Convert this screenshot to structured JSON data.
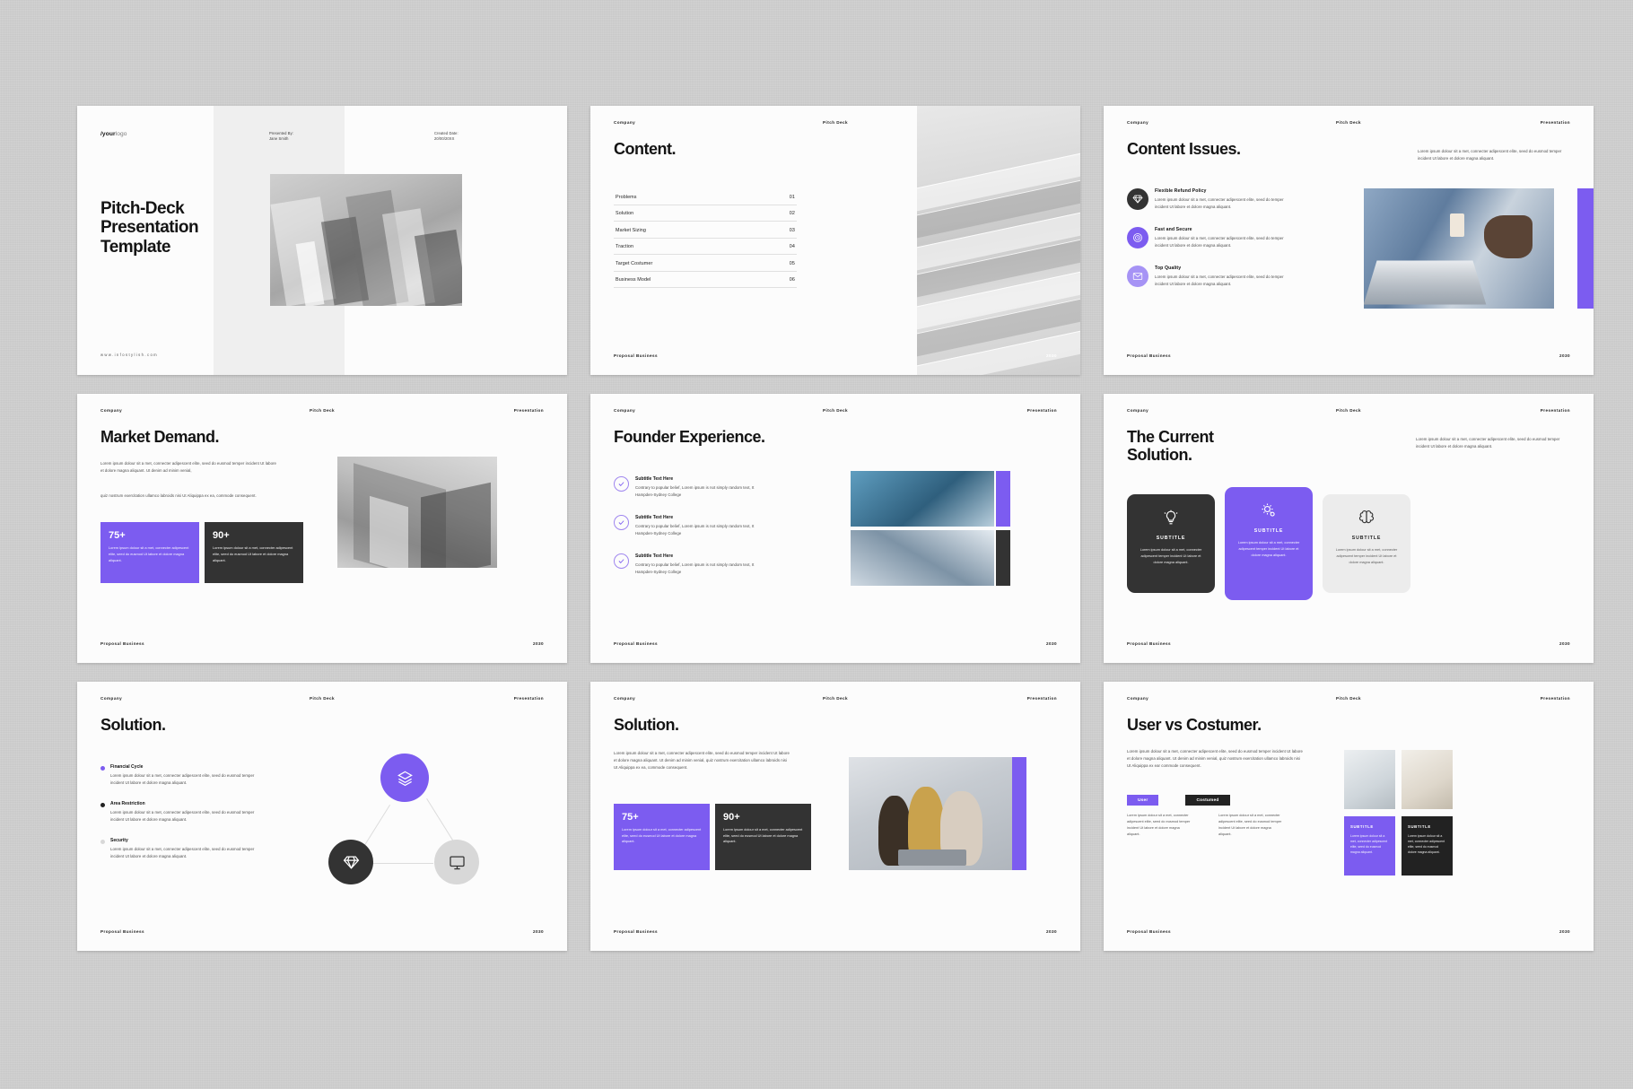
{
  "common": {
    "header_left": "Company",
    "header_center": "Pitch Deck",
    "header_right": "Presentation",
    "footer_left": "Proposal Business",
    "footer_right": "2030"
  },
  "slides": [
    {
      "id": "cover",
      "logo_bold": "/your",
      "logo_light": "logo",
      "presented_by_label": "Presented By:",
      "presented_by_name": "Jane Smith",
      "created_label": "Created Date:",
      "created_value": "20/00/20XX",
      "title": "Pitch-Deck Presentation Template",
      "url": "www.infostylish.com"
    },
    {
      "id": "content",
      "title": "Content.",
      "items": [
        {
          "label": "Problems",
          "num": "01"
        },
        {
          "label": "Solution",
          "num": "02"
        },
        {
          "label": "Market Sizing",
          "num": "03"
        },
        {
          "label": "Traction",
          "num": "04"
        },
        {
          "label": "Target Costumer",
          "num": "05"
        },
        {
          "label": "Business Model",
          "num": "06"
        }
      ]
    },
    {
      "id": "content-issues",
      "title": "Content Issues.",
      "lead": "Lorem ipsum dolour sit a met, connecter adipescent elite, seed do eusmod temper incident Ut labore et dolore magna aliquant.",
      "features": [
        {
          "icon": "diamond-icon",
          "title": "Flexible Refund Policy",
          "text": "Lorem ipsum dolour sit a met, connecter adipescent elite, seed do temper incident Ut labore et dolore magna aliquant.",
          "color": "#333333"
        },
        {
          "icon": "clock-icon",
          "title": "Fast and Secure",
          "text": "Lorem ipsum dolour sit a met, connecter adipescent elite, seed do temper incident Ut labore et dolore magna aliquant.",
          "color": "#7c5cf0"
        },
        {
          "icon": "envelope-icon",
          "title": "Top Quality",
          "text": "Lorem ipsum dolour sit a met, connecter adipescent elite, seed do temper incident Ut labore et dolore magna aliquant.",
          "color": "#a693f5"
        }
      ]
    },
    {
      "id": "market-demand",
      "title": "Market Demand.",
      "para1": "Lorem ipsum dolour sit a met, connecter adipescent elite, seed do eusmod temper incident Ut labore et dolore magna aliquant. Ut denim ad minim venial,",
      "para2": "quiz nostrum exercitation ullamco labroids nisi Ut Aliquippa ex ea, commode consequent.",
      "stats": [
        {
          "number": "75+",
          "text": "Lorem ipsum dolour sit a met, connecter adipescent elite, seed do eusmod Ut labore et dolore magna aliquant.",
          "color": "#7c5cf0"
        },
        {
          "number": "90+",
          "text": "Lorem ipsum dolour sit a met, connecter adipescent elite, seed do eusmod Ut labore et dolore magna aliquant.",
          "color": "#333333"
        }
      ]
    },
    {
      "id": "founder-experience",
      "title": "Founder Experience.",
      "items": [
        {
          "icon": "check-circle-icon",
          "title": "Subtitle Text Here",
          "text": "Contrary to popular belief, Lorem ipsum is not simply random text, It Hampden-Sydney  College"
        },
        {
          "icon": "check-circle-icon",
          "title": "Subtitle Text Here",
          "text": "Contrary to popular belief, Lorem ipsum is not simply random text, It Hampden-Sydney  College"
        },
        {
          "icon": "check-circle-icon",
          "title": "Subtitle Text Here",
          "text": "Contrary to popular belief, Lorem ipsum is not simply random text, It Hampden-Sydney  College"
        }
      ]
    },
    {
      "id": "current-solution",
      "title": "The Current Solution.",
      "lead": "Lorem ipsum dolour sit a met, connecter adipescent elite, seed do eusmod temper incident Ut labore et dolore magna aliquant.",
      "cards": [
        {
          "icon": "lightbulb-icon",
          "caption": "SUBTITLE",
          "text": "Lorem ipsum dolour sit a met, connecter adipescent temper incident Ut labore et dolore magna aliquant.",
          "color": "#333333"
        },
        {
          "icon": "gears-icon",
          "caption": "SUBTITLE",
          "text": "Lorem ipsum dolour sit a met, connecter adipescent temper incident Ut labore et dolore magna aliquant.",
          "color": "#7c5cf0"
        },
        {
          "icon": "brain-icon",
          "caption": "SUBTITLE",
          "text": "Lorem ipsum dolour sit a met, connecter adipescent temper incident Ut labore et dolore magna aliquant.",
          "color": "#ececec"
        }
      ]
    },
    {
      "id": "solution-diagram",
      "title": "Solution.",
      "bullets": [
        {
          "title": "Financial Cycle",
          "text": "Lorem ipsum dolour sit a met, connecter adipescent elite, seed do eusmod temper incident Ut labore et dolore magna aliquant.",
          "color": "#7c5cf0"
        },
        {
          "title": "Area Restriction",
          "text": "Lorem ipsum dolour sit a met, connecter adipescent elite, seed do eusmod temper incident Ut labore et dolore magna aliquant.",
          "color": "#222222"
        },
        {
          "title": "Security",
          "text": "Lorem ipsum dolour sit a met, connecter adipescent elite, seed do eusmod temper incident Ut labore et dolore magna aliquant.",
          "color": "#d8d8d8"
        }
      ],
      "nodes": [
        {
          "icon": "layers-icon",
          "color": "#7c5cf0"
        },
        {
          "icon": "diamond-icon",
          "color": "#333333"
        },
        {
          "icon": "monitor-icon",
          "color": "#d8d8d8"
        }
      ]
    },
    {
      "id": "solution-stats",
      "title": "Solution.",
      "para1": "Lorem ipsum dolour sit a met, connecter adipescent elite, seed do eusmod temper incident Ut labore et dolore magna aliquant. Ut denim ad minim venial, quiz nostrum exercitation ullamco labroids nisi Ut Aliquippa ex ea, commode consequent.",
      "stats": [
        {
          "number": "75+",
          "text": "Lorem ipsum dolour sit a met, connecter adipescent elite, seed do eusmod Ut labore et dolore magna aliquant.",
          "color": "#7c5cf0"
        },
        {
          "number": "90+",
          "text": "Lorem ipsum dolour sit a met, connecter adipescent elite, seed do eusmod Ut labore et dolore magna aliquant.",
          "color": "#333333"
        }
      ]
    },
    {
      "id": "user-vs-costumer",
      "title": "User vs Costumer.",
      "para1": "Lorem ipsum dolour sit a met, connecter adipescent elite, seed do eusmod temper incident Ut labore et dolore magna aliquant. Ut denim ad minim venial, quiz nostrum exercitation ullamco labroids nisi Ut Aliquippa ex ear commode consequent.",
      "chips": [
        {
          "label": "User",
          "color": "#7c5cf0"
        },
        {
          "label": "Costumed",
          "color": "#222222"
        }
      ],
      "columns": [
        "Lorem ipsum dolour sit a met, connecter adipescent elite, seed do eusmod temper incident Ut labore et dolore magna aliquant.",
        "Lorem ipsum dolour sit a met, connecter adipescent elite, seed do eusmod temper incident Ut labore et dolore magna aliquant."
      ],
      "panels": [
        {
          "caption": "SUBTITLE",
          "text": "Lorem ipsum dolour sit a met, connecter adipescent elite, seed do eusmod magna aliquant.",
          "color": "#7c5cf0"
        },
        {
          "caption": "SUBTITLE",
          "text": "Lorem ipsum dolour sit a met, connecter adipescent elite, seed do eusmod dolore magna aliquant.",
          "color": "#222222"
        }
      ]
    }
  ]
}
